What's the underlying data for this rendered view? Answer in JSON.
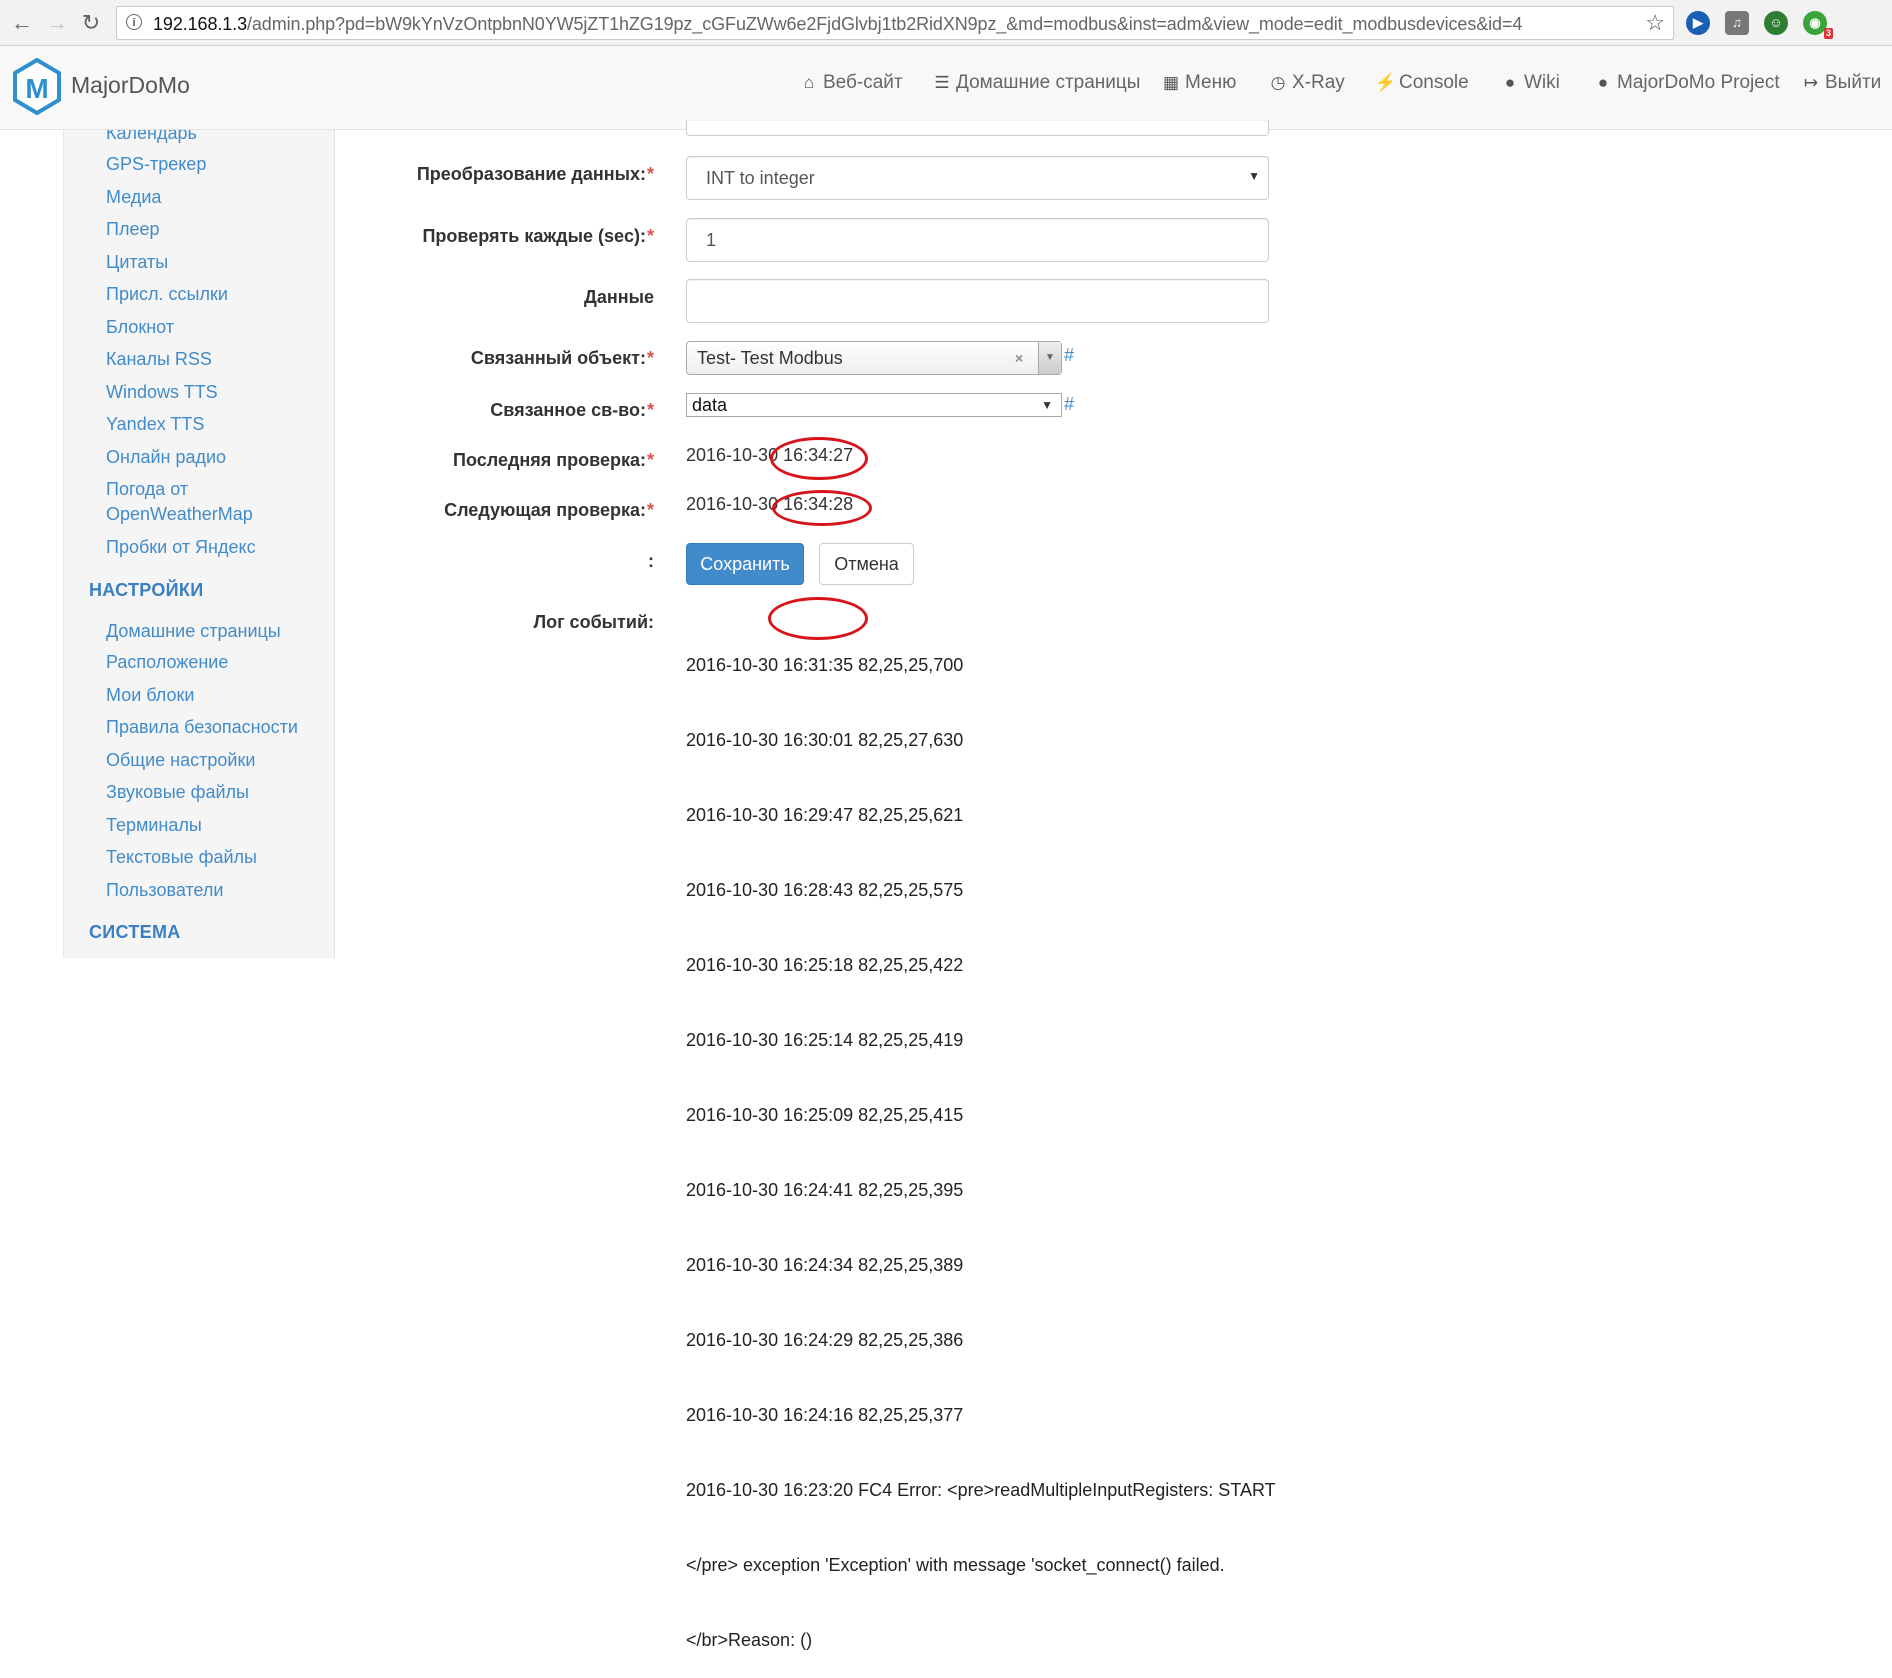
{
  "browser": {
    "url_host": "192.168.1.3",
    "url_path": "/admin.php?pd=bW9kYnVzOntpbnN0YW5jZT1hZG19pz_cGFuZWw6e2FjdGlvbj1tb2RidXN9pz_&md=modbus&inst=adm&view_mode=edit_modbusdevices&id=4",
    "info_icon": "i",
    "extension_badge": "3"
  },
  "navbar": {
    "brand": "MajorDoMo",
    "items": [
      {
        "icon": "home-icon",
        "label": "Веб-сайт"
      },
      {
        "icon": "list-icon",
        "label": "Домашние страницы"
      },
      {
        "icon": "th-list-icon",
        "label": "Меню"
      },
      {
        "icon": "dashboard-icon",
        "label": "X-Ray"
      },
      {
        "icon": "flash-icon",
        "label": "Console"
      },
      {
        "icon": "globe-icon",
        "label": "Wiki"
      },
      {
        "icon": "globe-icon",
        "label": "MajorDoMo Project"
      },
      {
        "icon": "logout-icon",
        "label": "Выйти"
      }
    ]
  },
  "sidebar": {
    "apps": [
      "Календарь",
      "GPS-трекер",
      "Медиа",
      "Плеер",
      "Цитаты",
      "Присл. ссылки",
      "Блокнот",
      "Каналы RSS",
      "Windows TTS",
      "Yandex TTS",
      "Онлайн радио",
      "Погода от",
      "OpenWeatherMap",
      "Пробки от Яндекс"
    ],
    "settings_heading": "НАСТРОЙКИ",
    "settings": [
      "Домашние страницы",
      "Расположение",
      "Мои блоки",
      "Правила безопасности",
      "Общие настройки",
      "Звуковые файлы",
      "Терминалы",
      "Текстовые файлы",
      "Пользователи"
    ],
    "system_heading": "СИСТЕМА"
  },
  "form": {
    "required_mark": "*",
    "conversion_label": "Преобразование данных:",
    "conversion_value": "INT to integer",
    "interval_label": "Проверять каждые (sec):",
    "interval_value": "1",
    "data_label": "Данные",
    "data_value": "",
    "linked_object_label": "Связанный объект:",
    "linked_object_value": "Test- Test Modbus",
    "linked_property_label": "Связанное св-во:",
    "linked_property_value": "data",
    "hash": "#",
    "last_check_label": "Последняя проверка:",
    "last_check_value": "2016-10-30 16:34:27",
    "next_check_label": "Следующая проверка:",
    "next_check_value": "2016-10-30 16:34:28",
    "actions_label": ":",
    "save_label": "Сохранить",
    "cancel_label": "Отмена",
    "log_label": "Лог событий:",
    "log_lines": [
      "2016-10-30 16:31:35 82,25,25,700",
      "2016-10-30 16:30:01 82,25,27,630",
      "2016-10-30 16:29:47 82,25,25,621",
      "2016-10-30 16:28:43 82,25,25,575",
      "2016-10-30 16:25:18 82,25,25,422",
      "2016-10-30 16:25:14 82,25,25,419",
      "2016-10-30 16:25:09 82,25,25,415",
      "2016-10-30 16:24:41 82,25,25,395",
      "2016-10-30 16:24:34 82,25,25,389",
      "2016-10-30 16:24:29 82,25,25,386",
      "2016-10-30 16:24:16 82,25,25,377",
      "2016-10-30 16:23:20 FC4 Error: <pre>readMultipleInputRegisters: START",
      "</pre> exception 'Exception' with message 'socket_connect() failed.",
      "</br>Reason: ()"
    ]
  },
  "colors": {
    "link": "#428bca",
    "primary_button": "#428bca",
    "required": "#d9534f",
    "annotation_ring": "#d7141a"
  }
}
